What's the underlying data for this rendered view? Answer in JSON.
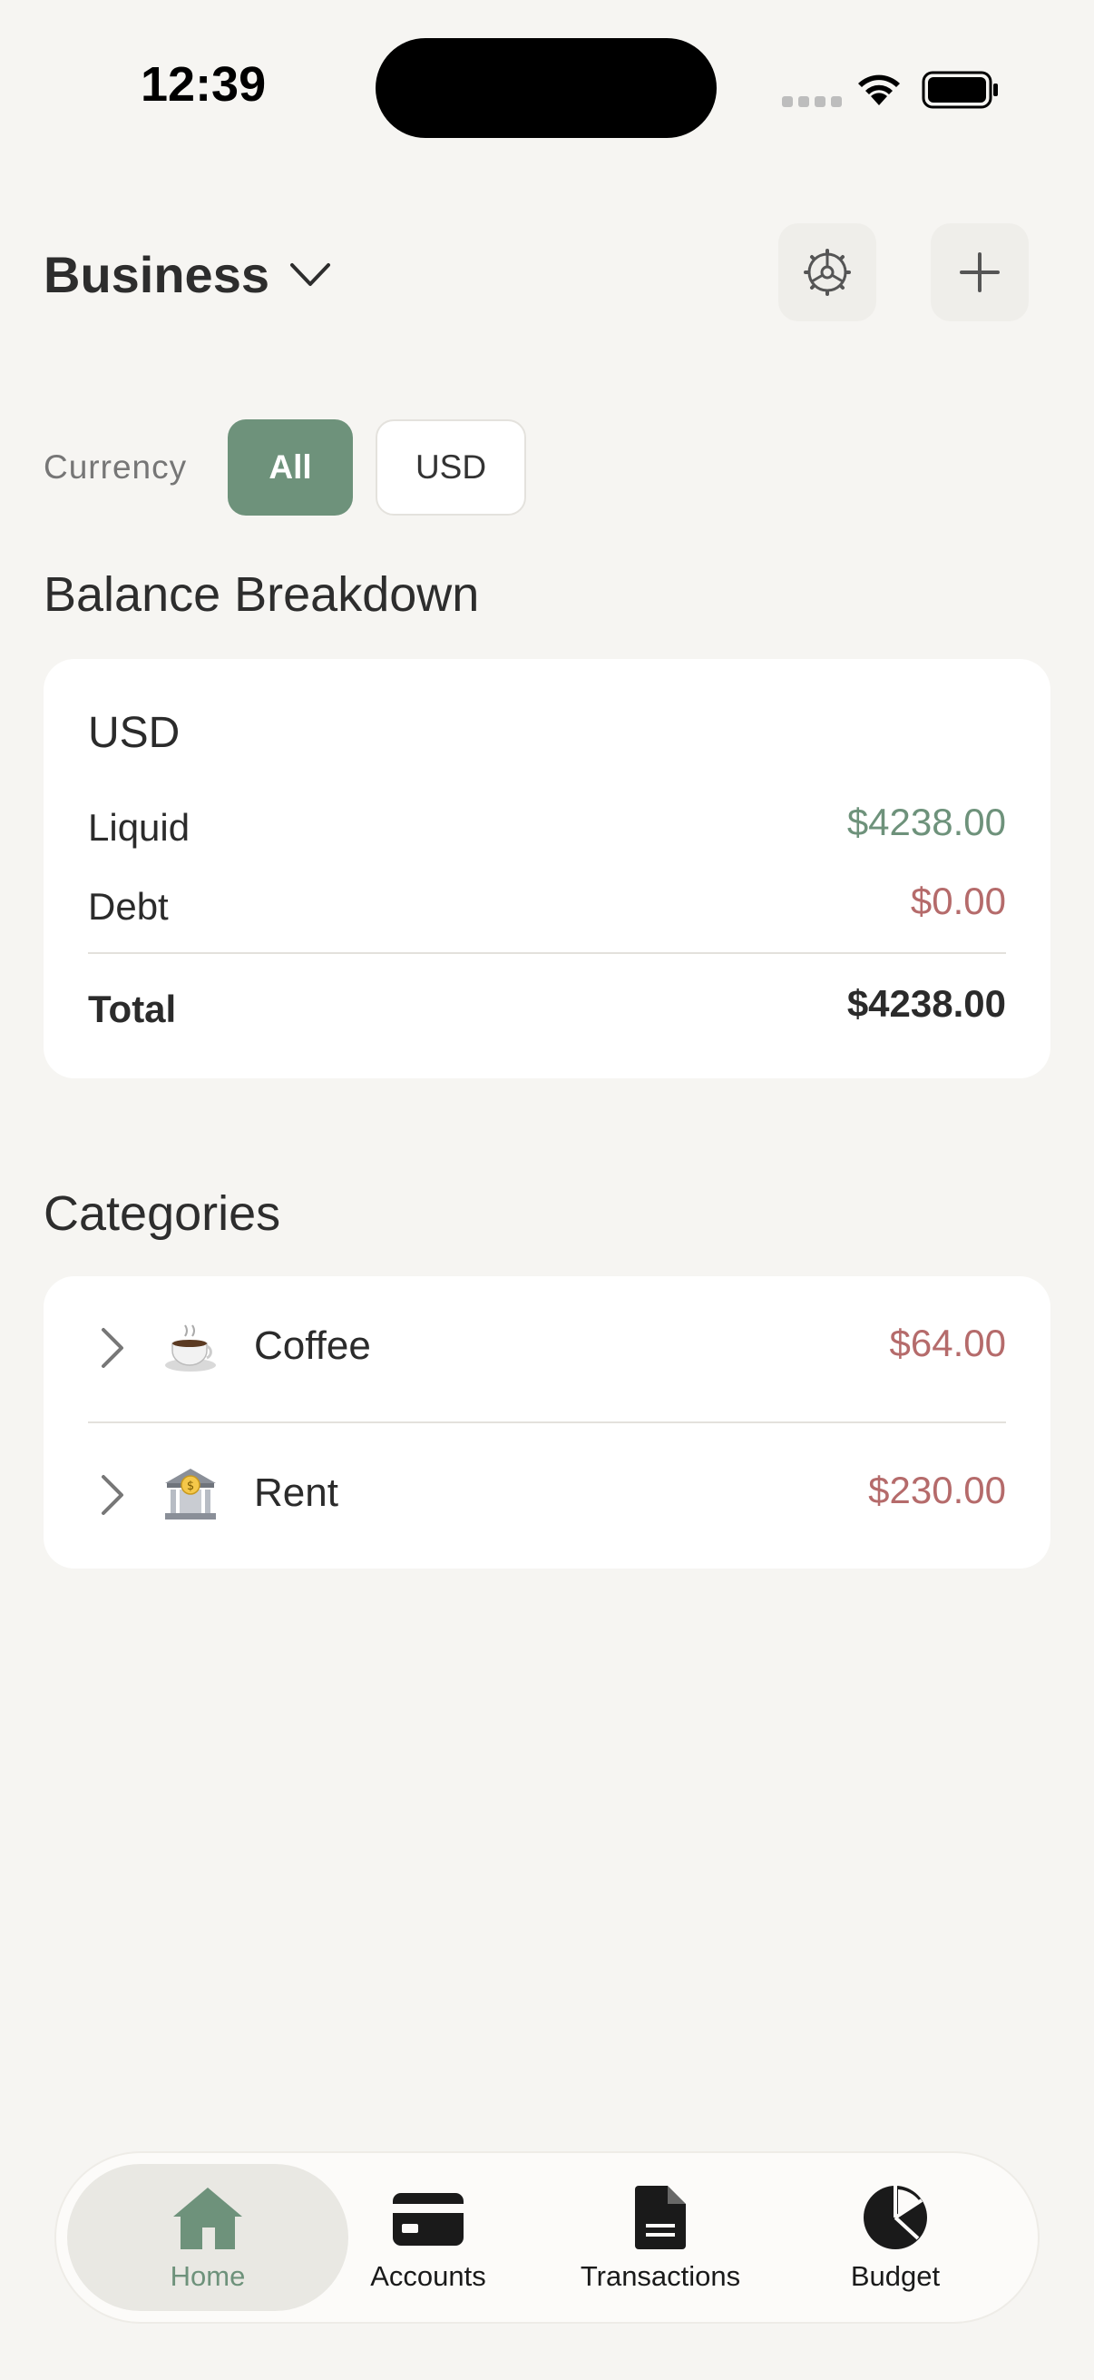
{
  "status_bar": {
    "time": "12:39"
  },
  "header": {
    "workspace_name": "Business"
  },
  "filter": {
    "label": "Currency",
    "options": [
      "All",
      "USD"
    ],
    "selected": "All"
  },
  "balance": {
    "section_title": "Balance Breakdown",
    "currency": "USD",
    "liquid_label": "Liquid",
    "liquid_value": "$4238.00",
    "debt_label": "Debt",
    "debt_value": "$0.00",
    "total_label": "Total",
    "total_value": "$4238.00"
  },
  "categories": {
    "section_title": "Categories",
    "items": [
      {
        "name": "Coffee",
        "icon": "coffee-cup-icon",
        "amount": "$64.00"
      },
      {
        "name": "Rent",
        "icon": "bank-icon",
        "amount": "$230.00"
      }
    ]
  },
  "tabbar": {
    "tabs": [
      {
        "label": "Home",
        "icon": "house-icon",
        "active": true
      },
      {
        "label": "Accounts",
        "icon": "card-icon",
        "active": false
      },
      {
        "label": "Transactions",
        "icon": "document-icon",
        "active": false
      },
      {
        "label": "Budget",
        "icon": "pie-chart-icon",
        "active": false
      }
    ]
  },
  "colors": {
    "accent": "#6e927b",
    "negative": "#b56b6b",
    "background": "#f6f5f2"
  }
}
